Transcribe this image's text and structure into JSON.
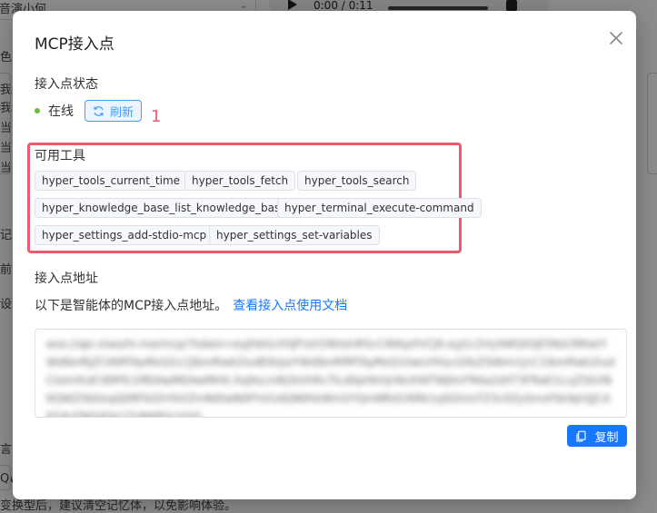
{
  "background": {
    "select_value": "音演小何",
    "audio_time": "0:00 / 0:11",
    "left_texts": [
      "色",
      "我",
      "我",
      "当",
      "当",
      "当",
      "记",
      "前",
      "设",
      "言",
      "Qw"
    ],
    "bottom_note": "变换型后，建议清空记忆体，以免影响体验。"
  },
  "dialog": {
    "title": "MCP接入点",
    "status_section": {
      "title": "接入点状态",
      "status_text": "在线",
      "refresh_label": "刷新",
      "annotation_number": "1"
    },
    "tools_section": {
      "title": "可用工具",
      "tools": [
        "hyper_tools_current_time",
        "hyper_tools_fetch",
        "hyper_tools_search",
        "hyper_knowledge_base_list_knowledge_base",
        "hyper_terminal_execute-command",
        "hyper_settings_add-stdio-mcp",
        "hyper_settings_set-variables"
      ]
    },
    "address_section": {
      "title": "接入点地址",
      "description": "以下是智能体的MCP接入点地址。",
      "doc_link": "查看接入点使用文档",
      "address_value": "wss://api.xiaozhi.me/mcp/?token=eyJhbGciOiJFUzI1NiIsInR5cCI6IkpXVCJ9.eyJ1c2VySWQiOjE5NzI3MiwiYWdlbnRJZCI6MTAyMzQ1LCJlbmRwb2ludElkIjoiYWdlbnRfMTAyMzQ1IiwicHVycG9zZSI6Im1jcC1lbmRwb2ludCIsImlhdCI6MTc1MDAwMDAwMH0.Xq9sLmN2bVhRcTlLd0pHbVpYeUhNTWJHcFR6a2dXT3FRaE1LcjZ5bVN6QWZXb0xqQ0RFbGhYbVZmN0twN0FhVUdQN0hkWm5YQmNRd1l6Rk1qSGtUcFZ3c0ZySmxFbk9pVjJCdEF4UTNOdGk1TUN6RS1XXQ"
    },
    "copy_label": "复制"
  },
  "colors": {
    "primary": "#1677ff",
    "online": "#67c23a",
    "highlight": "#f05a6e"
  }
}
